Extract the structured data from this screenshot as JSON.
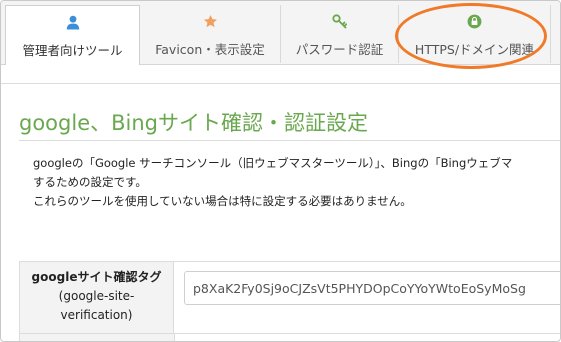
{
  "tabs": [
    {
      "label": "管理者向けツール",
      "icon": "user-icon",
      "icon_color": "#3b8fd9",
      "active": true
    },
    {
      "label": "Favicon・表示設定",
      "icon": "star-icon",
      "icon_color": "#f0a060",
      "active": false
    },
    {
      "label": "パスワード認証",
      "icon": "key-icon",
      "icon_color": "#6aa84f",
      "active": false
    },
    {
      "label": "HTTPS/ドメイン関連",
      "icon": "lock-icon",
      "icon_color": "#6aa84f",
      "active": false
    }
  ],
  "section": {
    "title": "google、Bingサイト確認・認証設定",
    "description_lines": [
      "googleの「Google サーチコンソール（旧ウェブマスターツール）」、Bingの「Bingウェブマ",
      "するための設定です。",
      "これらのツールを使用していない場合は特に設定する必要はありません。"
    ]
  },
  "settings": {
    "google_verification": {
      "label_line1": "googleサイト確認タグ",
      "label_line2": "(google-site-",
      "label_line3": "verification)",
      "value": "p8XaK2Fy0Sj9oCJZsVt5PHYDOpCoYYoYWtoEoSyMoSg"
    }
  },
  "colors": {
    "accent_green": "#6aa84f",
    "highlight_orange": "#f07a28"
  }
}
